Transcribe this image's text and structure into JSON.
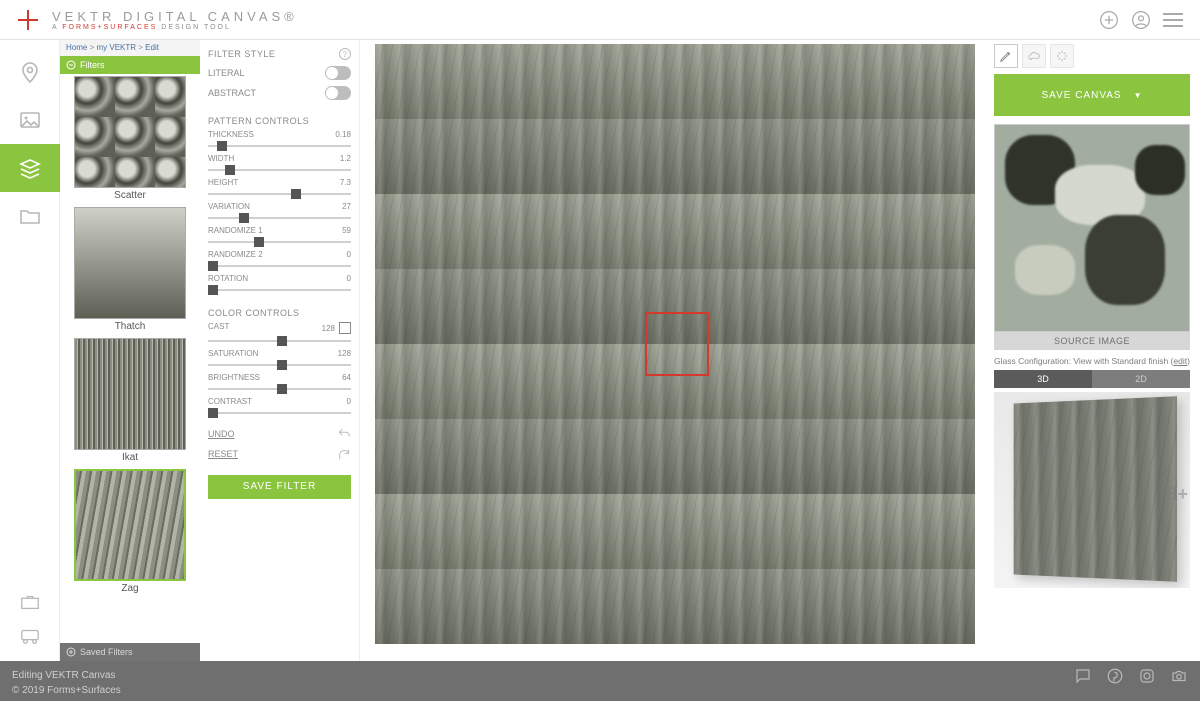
{
  "header": {
    "title": "VEKTR DIGITAL CANVAS®",
    "subtitle_prefix": "A ",
    "subtitle_brand": "FORMS+SURFACES",
    "subtitle_suffix": " DESIGN TOOL"
  },
  "breadcrumb": {
    "home": "Home",
    "sep": " > ",
    "mid": "my VEKTR",
    "leaf": "Edit"
  },
  "filters": {
    "header": "Filters",
    "saved_header": "Saved Filters",
    "items": [
      {
        "label": "Scatter",
        "selected": false,
        "texClass": "tex"
      },
      {
        "label": "Thatch",
        "selected": false,
        "texClass": "tex2"
      },
      {
        "label": "Ikat",
        "selected": false,
        "texClass": "tex3"
      },
      {
        "label": "Zag",
        "selected": true,
        "texClass": "tex4"
      }
    ]
  },
  "controls": {
    "filter_style": {
      "title": "FILTER STYLE",
      "literal": "LITERAL",
      "abstract": "ABSTRACT"
    },
    "pattern": {
      "title": "PATTERN CONTROLS",
      "items": [
        {
          "label": "THICKNESS",
          "value": "0.18",
          "pos": 6
        },
        {
          "label": "WIDTH",
          "value": "1.2",
          "pos": 12
        },
        {
          "label": "HEIGHT",
          "value": "7.3",
          "pos": 58
        },
        {
          "label": "VARIATION",
          "value": "27",
          "pos": 22
        },
        {
          "label": "RANDOMIZE 1",
          "value": "59",
          "pos": 32
        },
        {
          "label": "RANDOMIZE 2",
          "value": "0",
          "pos": 0
        },
        {
          "label": "ROTATION",
          "value": "0",
          "pos": 0
        }
      ]
    },
    "color": {
      "title": "COLOR CONTROLS",
      "items": [
        {
          "label": "CAST",
          "value": "128",
          "pos": 48,
          "swatch": true
        },
        {
          "label": "SATURATION",
          "value": "128",
          "pos": 48
        },
        {
          "label": "BRIGHTNESS",
          "value": "64",
          "pos": 48
        },
        {
          "label": "CONTRAST",
          "value": "0",
          "pos": 0
        }
      ]
    },
    "undo": "UNDO",
    "reset": "RESET",
    "save_filter": "SAVE FILTER"
  },
  "right": {
    "save_canvas": "SAVE CANVAS",
    "source_label": "SOURCE IMAGE",
    "glass_config_prefix": "Glass Configuration: View with Standard finish (",
    "glass_config_link": "edit",
    "glass_config_suffix": ")",
    "tabs": {
      "d3": "3D",
      "d2": "2D"
    }
  },
  "footer": {
    "line1": "Editing VEKTR Canvas",
    "line2": "© 2019 Forms+Surfaces"
  }
}
